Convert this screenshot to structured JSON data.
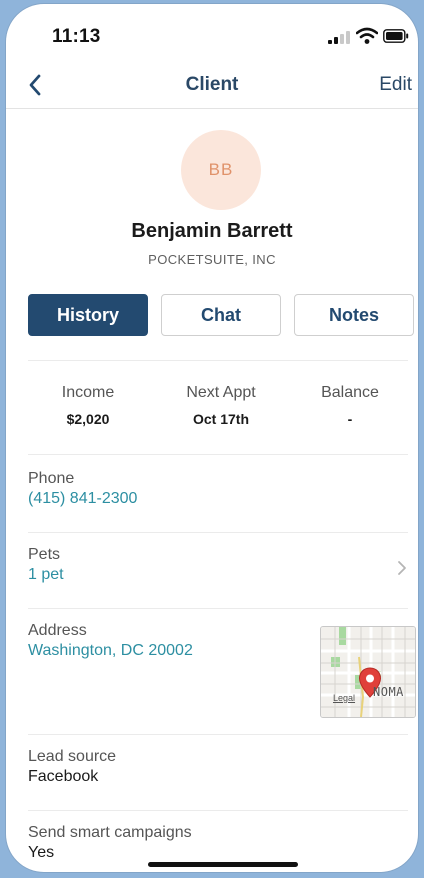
{
  "status_bar": {
    "time": "11:13"
  },
  "nav": {
    "title": "Client",
    "edit_label": "Edit"
  },
  "client": {
    "initials": "BB",
    "name": "Benjamin Barrett",
    "company": "POCKETSUITE, INC"
  },
  "tabs": [
    {
      "label": "History",
      "active": true
    },
    {
      "label": "Chat",
      "active": false
    },
    {
      "label": "Notes",
      "active": false
    }
  ],
  "stats": [
    {
      "label": "Income",
      "value": "$2,020"
    },
    {
      "label": "Next Appt",
      "value": "Oct 17th"
    },
    {
      "label": "Balance",
      "value": "-"
    }
  ],
  "details": {
    "phone": {
      "label": "Phone",
      "value": "(415) 841-2300"
    },
    "pets": {
      "label": "Pets",
      "value": "1 pet"
    },
    "address": {
      "label": "Address",
      "value": "Washington, DC 20002"
    },
    "lead_source": {
      "label": "Lead source",
      "value": "Facebook"
    },
    "smart_campaigns": {
      "label": "Send smart campaigns",
      "value": "Yes"
    }
  },
  "map": {
    "legal": "Legal",
    "area": "NOMA"
  },
  "colors": {
    "brand": "#234a70",
    "link": "#2d8fa2",
    "avatar_bg": "#fbe6db",
    "avatar_text": "#e0926a",
    "pin": "#e0403a"
  },
  "icons": {
    "back": "chevron-left-icon",
    "row_chevron": "chevron-right-icon",
    "map_pin": "map-pin-icon"
  }
}
